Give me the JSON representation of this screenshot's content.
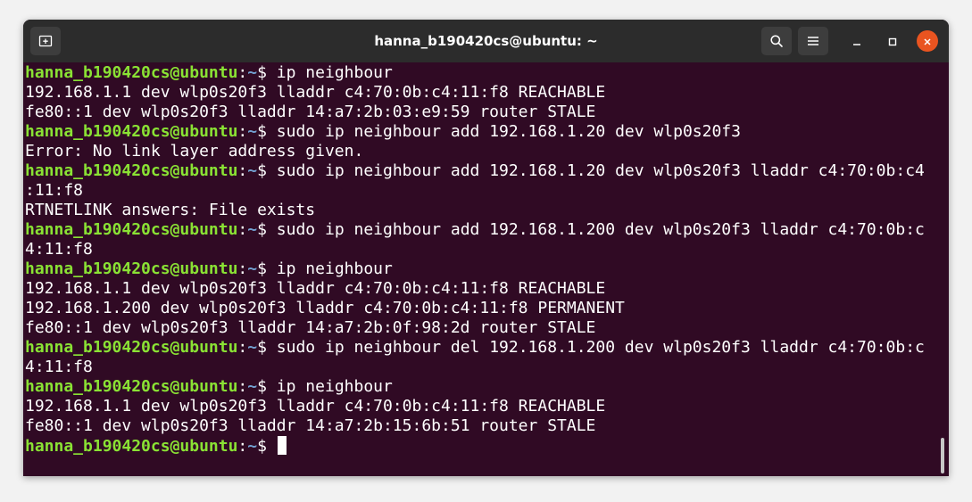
{
  "window": {
    "title": "hanna_b190420cs@ubuntu: ~",
    "accent_close": "#e95420"
  },
  "icons": {
    "new_tab": "new-tab-icon",
    "search": "search-icon",
    "menu": "hamburger-menu-icon",
    "minimize": "minimize-icon",
    "maximize": "maximize-icon",
    "close": "close-icon"
  },
  "colors": {
    "background": "#300a24",
    "user_host": "#8ae234",
    "path": "#729fcf",
    "text": "#ffffff"
  },
  "prompt": {
    "user_host": "hanna_b190420cs@ubuntu",
    "colon": ":",
    "path": "~",
    "symbol": "$ "
  },
  "terminal": {
    "lines": [
      {
        "type": "prompt",
        "cmd": "ip neighbour"
      },
      {
        "type": "output",
        "text": "192.168.1.1 dev wlp0s20f3 lladdr c4:70:0b:c4:11:f8 REACHABLE"
      },
      {
        "type": "output",
        "text": "fe80::1 dev wlp0s20f3 lladdr 14:a7:2b:03:e9:59 router STALE"
      },
      {
        "type": "prompt",
        "cmd": "sudo ip neighbour add 192.168.1.20 dev wlp0s20f3"
      },
      {
        "type": "output",
        "text": "Error: No link layer address given."
      },
      {
        "type": "prompt",
        "cmd": "sudo ip neighbour add 192.168.1.20 dev wlp0s20f3 lladdr c4:70:0b:c4"
      },
      {
        "type": "output",
        "text": ":11:f8"
      },
      {
        "type": "output",
        "text": "RTNETLINK answers: File exists"
      },
      {
        "type": "prompt",
        "cmd": "sudo ip neighbour add 192.168.1.200 dev wlp0s20f3 lladdr c4:70:0b:c"
      },
      {
        "type": "output",
        "text": "4:11:f8"
      },
      {
        "type": "prompt",
        "cmd": "ip neighbour"
      },
      {
        "type": "output",
        "text": "192.168.1.1 dev wlp0s20f3 lladdr c4:70:0b:c4:11:f8 REACHABLE"
      },
      {
        "type": "output",
        "text": "192.168.1.200 dev wlp0s20f3 lladdr c4:70:0b:c4:11:f8 PERMANENT"
      },
      {
        "type": "output",
        "text": "fe80::1 dev wlp0s20f3 lladdr 14:a7:2b:0f:98:2d router STALE"
      },
      {
        "type": "prompt",
        "cmd": "sudo ip neighbour del 192.168.1.200 dev wlp0s20f3 lladdr c4:70:0b:c"
      },
      {
        "type": "output",
        "text": "4:11:f8"
      },
      {
        "type": "prompt",
        "cmd": "ip neighbour"
      },
      {
        "type": "output",
        "text": "192.168.1.1 dev wlp0s20f3 lladdr c4:70:0b:c4:11:f8 REACHABLE"
      },
      {
        "type": "output",
        "text": "fe80::1 dev wlp0s20f3 lladdr 14:a7:2b:15:6b:51 router STALE"
      },
      {
        "type": "prompt",
        "cmd": "",
        "cursor": true
      }
    ]
  }
}
